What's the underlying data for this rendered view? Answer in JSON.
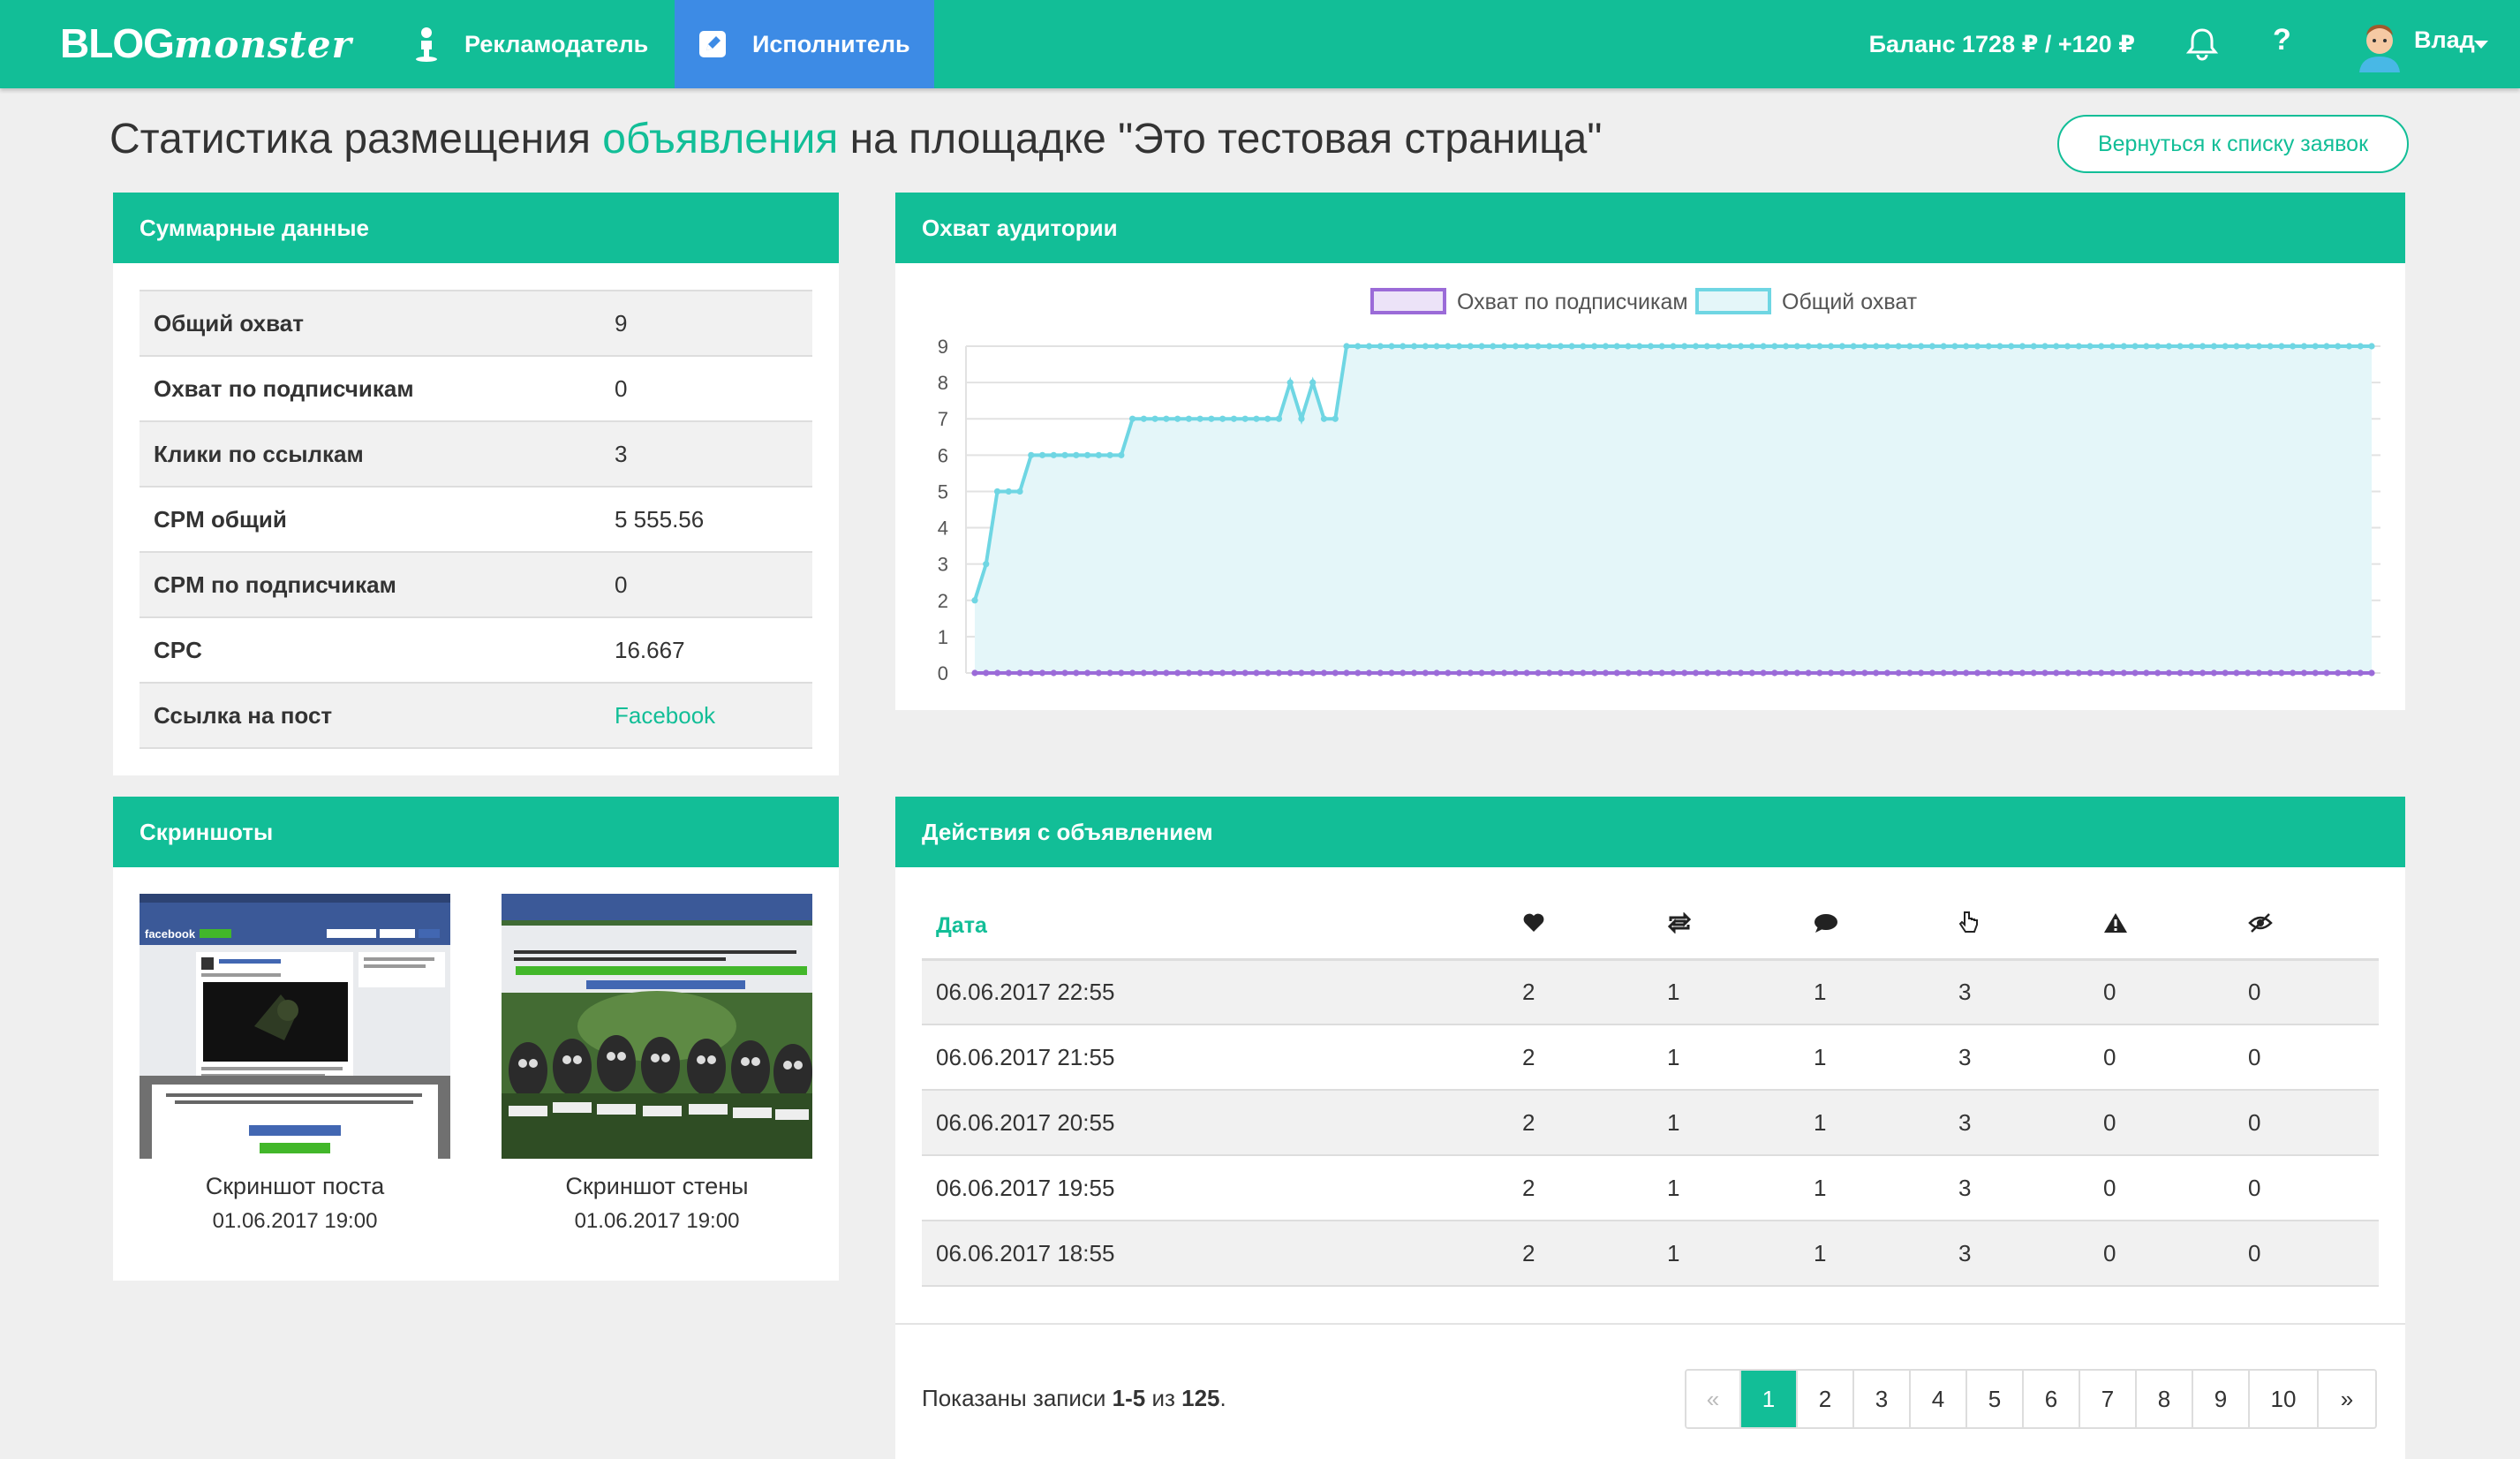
{
  "nav": {
    "logo_bold": "BLOG",
    "logo_script": "monster",
    "advertiser": "Рекламодатель",
    "executor": "Исполнитель",
    "balance": "Баланс 1728 ₽ / +120 ₽",
    "help": "?",
    "user": "Влад"
  },
  "page": {
    "title_pre": "Статистика размещения ",
    "title_accent": "объявления",
    "title_post": " на площадке \"Это тестовая страница\"",
    "back_button": "Вернуться к списку заявок"
  },
  "summary": {
    "title": "Суммарные данные",
    "rows": [
      {
        "label": "Общий охват",
        "value": "9"
      },
      {
        "label": "Охват по подписчикам",
        "value": "0"
      },
      {
        "label": "Клики по ссылкам",
        "value": "3"
      },
      {
        "label": "CPM общий",
        "value": "5 555.56"
      },
      {
        "label": "CPM по подписчикам",
        "value": "0"
      },
      {
        "label": "CPC",
        "value": "16.667"
      },
      {
        "label": "Ссылка на пост",
        "value": "Facebook"
      }
    ]
  },
  "reach": {
    "title": "Охват аудитории"
  },
  "chart_data": {
    "type": "line",
    "title": "Охват аудитории",
    "ylim": [
      0,
      9
    ],
    "yticks": [
      "0",
      "1",
      "2",
      "3",
      "4",
      "5",
      "6",
      "7",
      "8",
      "9"
    ],
    "grid": true,
    "legend": "top-center",
    "series": [
      {
        "name": "Охват по подписчикам",
        "color": "#9b6bd8",
        "values": [
          0,
          0,
          0,
          0,
          0,
          0,
          0,
          0,
          0,
          0,
          0,
          0,
          0,
          0,
          0,
          0,
          0,
          0,
          0,
          0,
          0,
          0,
          0,
          0,
          0,
          0,
          0,
          0,
          0,
          0,
          0,
          0,
          0,
          0,
          0,
          0,
          0,
          0,
          0,
          0,
          0,
          0,
          0,
          0,
          0,
          0,
          0,
          0,
          0,
          0,
          0,
          0,
          0,
          0,
          0,
          0,
          0,
          0,
          0,
          0,
          0,
          0,
          0,
          0,
          0,
          0,
          0,
          0,
          0,
          0,
          0,
          0,
          0,
          0,
          0,
          0,
          0,
          0,
          0,
          0,
          0,
          0,
          0,
          0,
          0,
          0,
          0,
          0,
          0,
          0,
          0,
          0,
          0,
          0,
          0,
          0,
          0,
          0,
          0,
          0,
          0,
          0,
          0,
          0,
          0,
          0,
          0,
          0,
          0,
          0,
          0,
          0,
          0,
          0,
          0,
          0,
          0,
          0,
          0,
          0,
          0,
          0,
          0,
          0,
          0
        ]
      },
      {
        "name": "Общий охват",
        "color": "#6fd6e3",
        "values": [
          2,
          3,
          5,
          5,
          5,
          6,
          6,
          6,
          6,
          6,
          6,
          6,
          6,
          6,
          7,
          7,
          7,
          7,
          7,
          7,
          7,
          7,
          7,
          7,
          7,
          7,
          7,
          7,
          8,
          7,
          8,
          7,
          7,
          9,
          9,
          9,
          9,
          9,
          9,
          9,
          9,
          9,
          9,
          9,
          9,
          9,
          9,
          9,
          9,
          9,
          9,
          9,
          9,
          9,
          9,
          9,
          9,
          9,
          9,
          9,
          9,
          9,
          9,
          9,
          9,
          9,
          9,
          9,
          9,
          9,
          9,
          9,
          9,
          9,
          9,
          9,
          9,
          9,
          9,
          9,
          9,
          9,
          9,
          9,
          9,
          9,
          9,
          9,
          9,
          9,
          9,
          9,
          9,
          9,
          9,
          9,
          9,
          9,
          9,
          9,
          9,
          9,
          9,
          9,
          9,
          9,
          9,
          9,
          9,
          9,
          9,
          9,
          9,
          9,
          9,
          9,
          9,
          9,
          9,
          9,
          9,
          9,
          9,
          9,
          9
        ]
      }
    ]
  },
  "screenshots": {
    "title": "Скриншоты",
    "items": [
      {
        "caption": "Скриншот поста",
        "date": "01.06.2017 19:00",
        "brand": "facebook"
      },
      {
        "caption": "Скриншот стены",
        "date": "01.06.2017 19:00",
        "brand": "facebook"
      }
    ]
  },
  "actions": {
    "title": "Действия с объявлением",
    "columns": {
      "date": "Дата",
      "icons": [
        "heart-icon",
        "repost-icon",
        "comment-icon",
        "click-icon",
        "warning-icon",
        "hidden-icon"
      ]
    },
    "rows": [
      {
        "date": "06.06.2017 22:55",
        "likes": "2",
        "reposts": "1",
        "comments": "1",
        "clicks": "3",
        "complaints": "0",
        "hides": "0"
      },
      {
        "date": "06.06.2017 21:55",
        "likes": "2",
        "reposts": "1",
        "comments": "1",
        "clicks": "3",
        "complaints": "0",
        "hides": "0"
      },
      {
        "date": "06.06.2017 20:55",
        "likes": "2",
        "reposts": "1",
        "comments": "1",
        "clicks": "3",
        "complaints": "0",
        "hides": "0"
      },
      {
        "date": "06.06.2017 19:55",
        "likes": "2",
        "reposts": "1",
        "comments": "1",
        "clicks": "3",
        "complaints": "0",
        "hides": "0"
      },
      {
        "date": "06.06.2017 18:55",
        "likes": "2",
        "reposts": "1",
        "comments": "1",
        "clicks": "3",
        "complaints": "0",
        "hides": "0"
      }
    ],
    "records_pre": "Показаны записи ",
    "records_range": "1-5",
    "records_mid": " из ",
    "records_total": "125",
    "records_post": ".",
    "pagination": [
      "«",
      "1",
      "2",
      "3",
      "4",
      "5",
      "6",
      "7",
      "8",
      "9",
      "10",
      "»"
    ],
    "current_page": "1"
  },
  "colors": {
    "brand": "#12be97",
    "executor_tab": "#3d8be5"
  }
}
